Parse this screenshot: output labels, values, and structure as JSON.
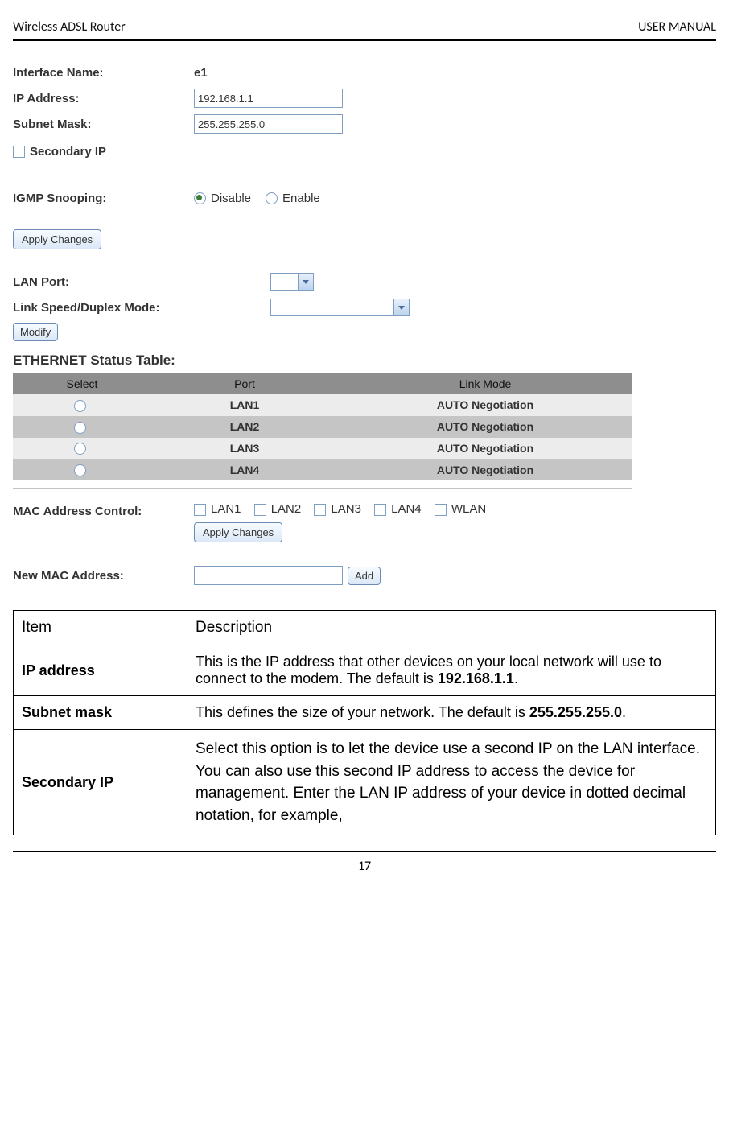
{
  "header": {
    "left": "Wireless ADSL Router",
    "right": "USER MANUAL"
  },
  "config": {
    "iface_label": "Interface Name:",
    "iface_value": "e1",
    "ip_label": "IP Address:",
    "ip_value": "192.168.1.1",
    "mask_label": "Subnet Mask:",
    "mask_value": "255.255.255.0",
    "secondary_label": "Secondary IP",
    "igmp_label": "IGMP Snooping:",
    "igmp_disable": "Disable",
    "igmp_enable": "Enable",
    "apply_btn": "Apply Changes",
    "lanport_label": "LAN Port:",
    "linkspeed_label": "Link Speed/Duplex Mode:",
    "modify_btn": "Modify",
    "eth_table_title": "ETHERNET Status Table:",
    "eth_cols": {
      "select": "Select",
      "port": "Port",
      "mode": "Link Mode"
    },
    "eth_rows": [
      {
        "port": "LAN1",
        "mode": "AUTO Negotiation"
      },
      {
        "port": "LAN2",
        "mode": "AUTO Negotiation"
      },
      {
        "port": "LAN3",
        "mode": "AUTO Negotiation"
      },
      {
        "port": "LAN4",
        "mode": "AUTO Negotiation"
      }
    ],
    "maccontrol_label": "MAC Address Control:",
    "maccontrol_opts": [
      "LAN1",
      "LAN2",
      "LAN3",
      "LAN4",
      "WLAN"
    ],
    "apply_btn2": "Apply Changes",
    "newmac_label": "New MAC Address:",
    "add_btn": "Add"
  },
  "desc_table": {
    "head": {
      "item": "Item",
      "desc": "Description"
    },
    "rows": [
      {
        "item": "IP address",
        "desc_a": "This is the IP address that other devices on your local network will use to connect to the modem. The default is ",
        "desc_b": "192.168.1.1",
        "desc_c": "."
      },
      {
        "item": "Subnet mask",
        "desc_a": "This defines the size of your network. The default is ",
        "desc_b": "255.255.255.0",
        "desc_c": "."
      },
      {
        "item": "Secondary IP",
        "desc": "Select this option is to let the device use a second IP on the LAN interface. You can also use this second IP address to access the device for management. Enter the LAN IP address of your device in dotted decimal notation, for example,"
      }
    ]
  },
  "footer": {
    "page": "17"
  }
}
